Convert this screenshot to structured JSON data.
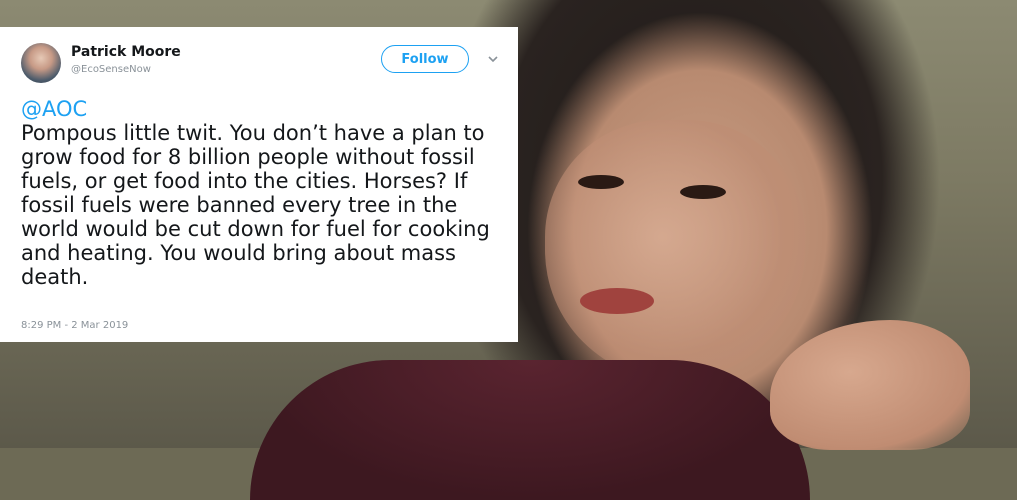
{
  "tweet": {
    "author_name": "Patrick Moore",
    "author_handle": "@EcoSenseNow",
    "follow_label": "Follow",
    "mention": "@AOC",
    "text": "Pompous little twit. You don’t have a plan to grow food for 8 billion people without fossil fuels, or get food into the cities. Horses? If fossil fuels were banned every tree in the world would be cut down for fuel for cooking and heating. You would bring about mass death.",
    "timestamp": "8:29 PM - 2 Mar 2019",
    "icons": {
      "menu": "chevron-down-icon",
      "avatar": "avatar"
    },
    "colors": {
      "accent": "#1da1f2",
      "text": "#14171a",
      "muted": "#8a9299"
    }
  }
}
